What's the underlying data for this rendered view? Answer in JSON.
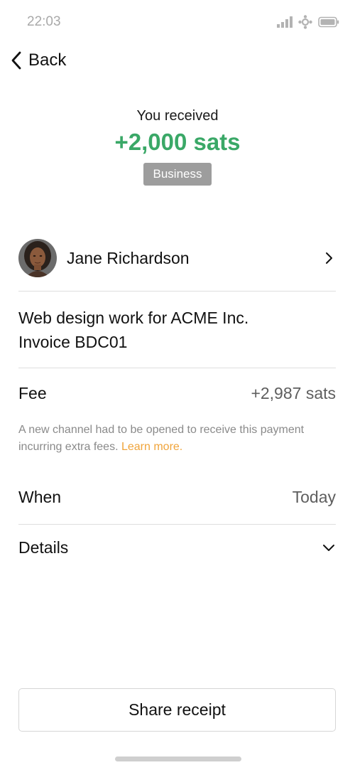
{
  "status_bar": {
    "time": "22:03",
    "icons": [
      "signal-icon",
      "network-icon",
      "battery-icon"
    ]
  },
  "nav": {
    "back_label": "Back",
    "back_icon": "chevron-left-icon"
  },
  "transaction": {
    "direction_label": "You received",
    "amount": "+2,000 sats",
    "amount_color": "#3aa867",
    "category_badge": "Business"
  },
  "contact": {
    "name": "Jane Richardson",
    "avatar": "avatar-photo",
    "chevron_icon": "chevron-right-icon"
  },
  "memo": {
    "line1": "Web design work for ACME Inc.",
    "line2": "Invoice BDC01"
  },
  "fee": {
    "label": "Fee",
    "value": "+2,987 sats",
    "note": "A new channel had to be opened to receive this payment incurring extra fees.",
    "learn_more": "Learn more.",
    "learn_more_color": "#f0a43a"
  },
  "when": {
    "label": "When",
    "value": "Today"
  },
  "details": {
    "label": "Details",
    "icon": "chevron-down-icon"
  },
  "actions": {
    "share_label": "Share receipt"
  }
}
